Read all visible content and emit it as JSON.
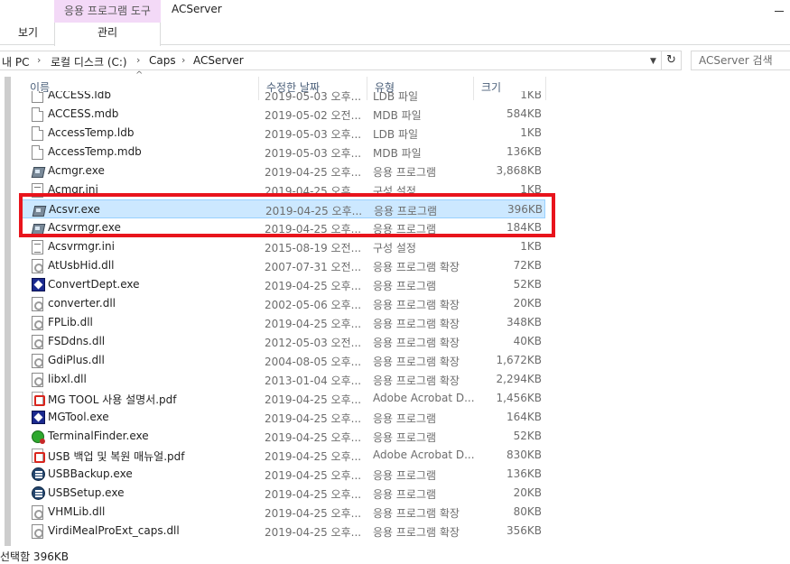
{
  "ribbon": {
    "context_tab": "응용 프로그램 도구",
    "window_title": "ACServer",
    "tabs": [
      {
        "label": "보기"
      },
      {
        "label": "관리"
      }
    ]
  },
  "address_bar": {
    "path": [
      "내 PC",
      "로컬 디스크 (C:)",
      "Caps",
      "ACServer"
    ],
    "separator": "›",
    "dropdown_icon": "chevron-down-icon",
    "refresh_icon": "refresh-icon",
    "refresh_glyph": "↻"
  },
  "search": {
    "placeholder": "ACServer 검색"
  },
  "columns": {
    "name": "이름",
    "date": "수정한 날짜",
    "type": "유형",
    "size": "크기",
    "sort_glyph": "^"
  },
  "files": [
    {
      "name": "ACCESS.ldb",
      "date": "2019-05-03 오후...",
      "type": "LDB 파일",
      "size": "1KB",
      "icon": "doc"
    },
    {
      "name": "ACCESS.mdb",
      "date": "2019-05-02 오전...",
      "type": "MDB 파일",
      "size": "584KB",
      "icon": "doc"
    },
    {
      "name": "AccessTemp.ldb",
      "date": "2019-05-03 오후...",
      "type": "LDB 파일",
      "size": "1KB",
      "icon": "doc"
    },
    {
      "name": "AccessTemp.mdb",
      "date": "2019-05-03 오후...",
      "type": "MDB 파일",
      "size": "136KB",
      "icon": "doc"
    },
    {
      "name": "Acmgr.exe",
      "date": "2019-04-25 오후...",
      "type": "응용 프로그램",
      "size": "3,868KB",
      "icon": "exe-ac"
    },
    {
      "name": "Acmgr.ini",
      "date": "2019-04-25 오후...",
      "type": "구성 설정",
      "size": "1KB",
      "icon": "ini"
    },
    {
      "name": "Acsvr.exe",
      "date": "2019-04-25 오후...",
      "type": "응용 프로그램",
      "size": "396KB",
      "icon": "exe-ac",
      "selected": true
    },
    {
      "name": "Acsvrmgr.exe",
      "date": "2019-04-25 오후...",
      "type": "응용 프로그램",
      "size": "184KB",
      "icon": "exe-ac"
    },
    {
      "name": "Acsvrmgr.ini",
      "date": "2015-08-19 오전...",
      "type": "구성 설정",
      "size": "1KB",
      "icon": "ini"
    },
    {
      "name": "AtUsbHid.dll",
      "date": "2007-07-31 오전...",
      "type": "응용 프로그램 확장",
      "size": "72KB",
      "icon": "dll"
    },
    {
      "name": "ConvertDept.exe",
      "date": "2019-04-25 오후...",
      "type": "응용 프로그램",
      "size": "52KB",
      "icon": "exe-blue"
    },
    {
      "name": "converter.dll",
      "date": "2002-05-06 오후...",
      "type": "응용 프로그램 확장",
      "size": "20KB",
      "icon": "dll"
    },
    {
      "name": "FPLib.dll",
      "date": "2019-04-25 오후...",
      "type": "응용 프로그램 확장",
      "size": "348KB",
      "icon": "dll"
    },
    {
      "name": "FSDdns.dll",
      "date": "2012-05-03 오전...",
      "type": "응용 프로그램 확장",
      "size": "40KB",
      "icon": "dll"
    },
    {
      "name": "GdiPlus.dll",
      "date": "2004-08-05 오후...",
      "type": "응용 프로그램 확장",
      "size": "1,672KB",
      "icon": "dll"
    },
    {
      "name": "libxl.dll",
      "date": "2013-01-04 오후...",
      "type": "응용 프로그램 확장",
      "size": "2,294KB",
      "icon": "dll"
    },
    {
      "name": "MG TOOL 사용 설명서.pdf",
      "date": "2019-04-25 오후...",
      "type": "Adobe Acrobat D...",
      "size": "1,456KB",
      "icon": "pdf"
    },
    {
      "name": "MGTool.exe",
      "date": "2019-04-25 오후...",
      "type": "응용 프로그램",
      "size": "164KB",
      "icon": "exe-blue"
    },
    {
      "name": "TerminalFinder.exe",
      "date": "2019-04-25 오후...",
      "type": "응용 프로그램",
      "size": "52KB",
      "icon": "exe-green"
    },
    {
      "name": "USB 백업 및 복원 매뉴얼.pdf",
      "date": "2019-04-25 오후...",
      "type": "Adobe Acrobat D...",
      "size": "830KB",
      "icon": "pdf"
    },
    {
      "name": "USBBackup.exe",
      "date": "2019-04-25 오후...",
      "type": "응용 프로그램",
      "size": "136KB",
      "icon": "exe-usb"
    },
    {
      "name": "USBSetup.exe",
      "date": "2019-04-25 오후...",
      "type": "응용 프로그램",
      "size": "20KB",
      "icon": "exe-usb"
    },
    {
      "name": "VHMLib.dll",
      "date": "2019-04-25 오후...",
      "type": "응용 프로그램 확장",
      "size": "80KB",
      "icon": "dll"
    },
    {
      "name": "VirdiMealProExt_caps.dll",
      "date": "2019-04-25 오후...",
      "type": "응용 프로그램 확장",
      "size": "356KB",
      "icon": "dll"
    }
  ],
  "status": {
    "text": "선택함 396KB"
  },
  "colors": {
    "selection": "#cce8ff",
    "highlight": "#e8141c",
    "context_tab": "#f3d9f7"
  }
}
